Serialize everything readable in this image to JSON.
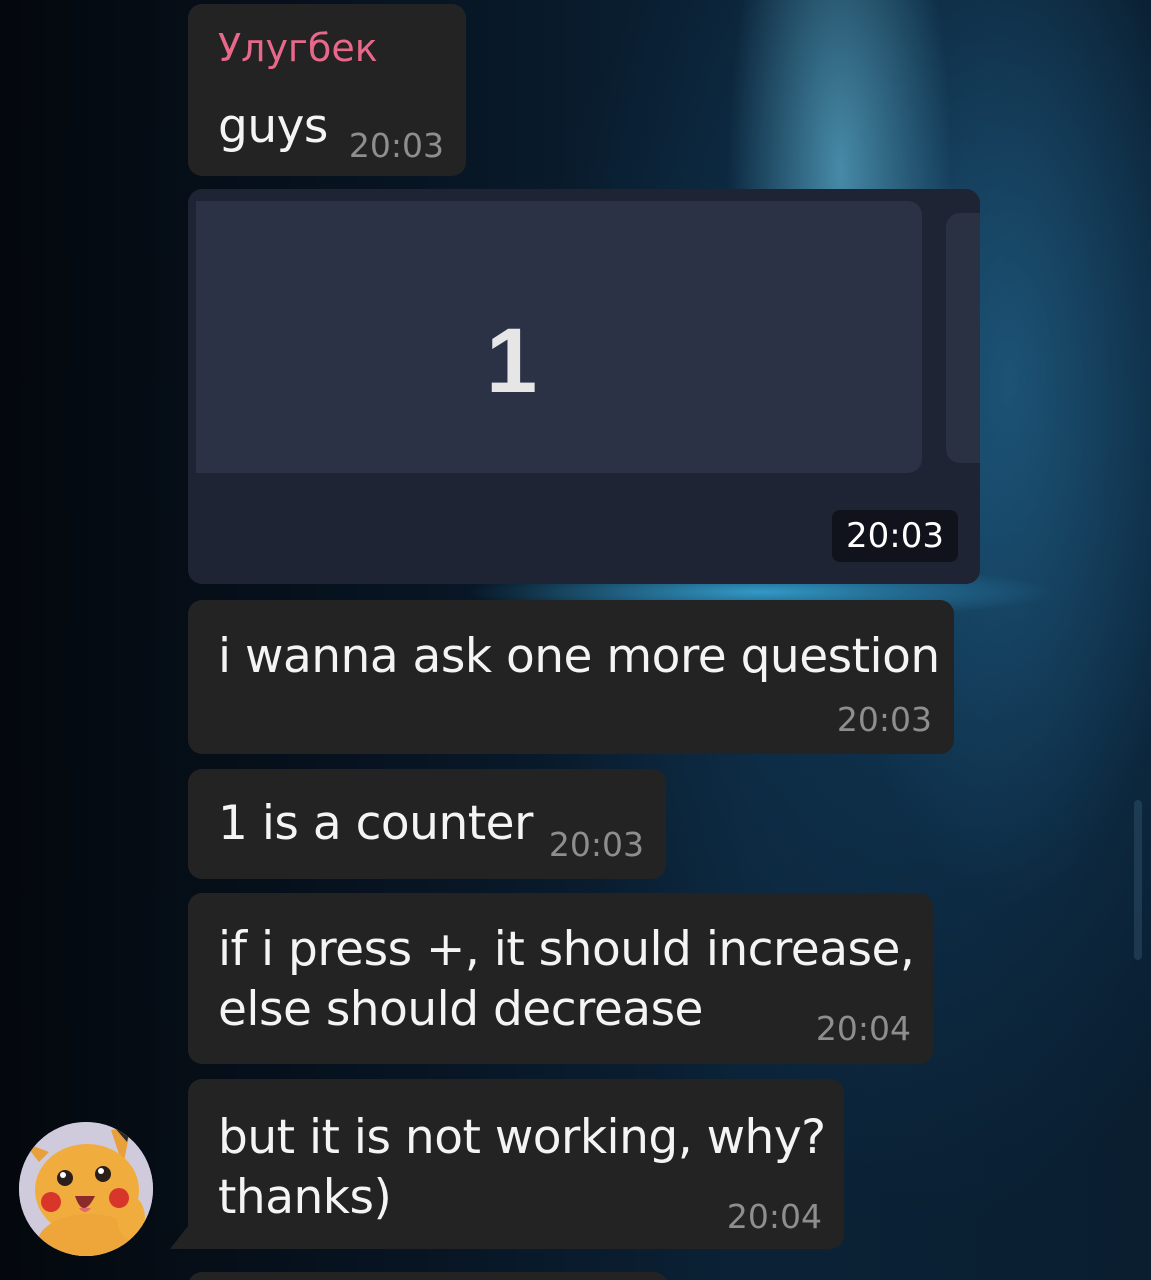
{
  "messages": [
    {
      "sender": "Улугбек",
      "text": "guys",
      "time": "20:03"
    },
    {
      "type": "photo",
      "photo_text": "1",
      "time": "20:03"
    },
    {
      "text": "i wanna ask one more question",
      "time": "20:03"
    },
    {
      "text": "1 is a counter",
      "time": "20:03"
    },
    {
      "lines": [
        "if i press +, it should increase,",
        "else should decrease"
      ],
      "time": "20:04"
    },
    {
      "lines": [
        "but it is not working, why?",
        "thanks)"
      ],
      "time": "20:04"
    }
  ],
  "colors": {
    "sender_name": "#e8688a",
    "bubble": "#232323",
    "timestamp": "#8e8e8e",
    "photo_bg": "#2b3246"
  },
  "icons": {
    "avatar": "pikachu-avatar"
  }
}
